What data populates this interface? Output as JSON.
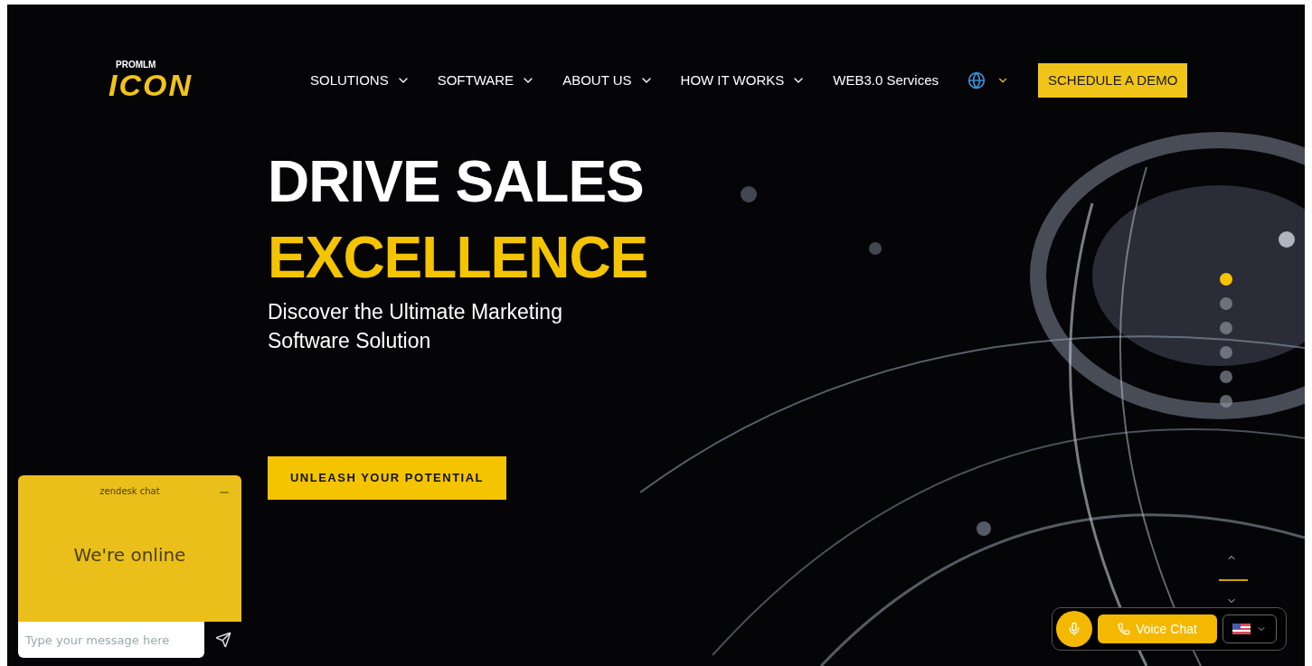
{
  "logo": {
    "top": "PROMLM",
    "main": "ICON"
  },
  "nav": [
    {
      "label": "SOLUTIONS",
      "dropdown": true
    },
    {
      "label": "SOFTWARE",
      "dropdown": true
    },
    {
      "label": "ABOUT US",
      "dropdown": true
    },
    {
      "label": "HOW IT WORKS",
      "dropdown": true
    },
    {
      "label": "WEB3.0 Services",
      "dropdown": false
    }
  ],
  "cta": "SCHEDULE A DEMO",
  "hero": {
    "line1": "DRIVE SALES",
    "line2": "EXCELLENCE",
    "subtitle": "Discover the Ultimate Marketing Software Solution",
    "button": "UNLEASH YOUR POTENTIAL"
  },
  "slides": [
    {
      "selected": true
    },
    {
      "selected": false
    },
    {
      "selected": false
    },
    {
      "selected": false
    },
    {
      "selected": false
    },
    {
      "selected": false
    }
  ],
  "chat": {
    "title": "zendesk chat",
    "status": "We're online",
    "placeholder": "Type your message here"
  },
  "voice": {
    "label": "Voice Chat"
  }
}
